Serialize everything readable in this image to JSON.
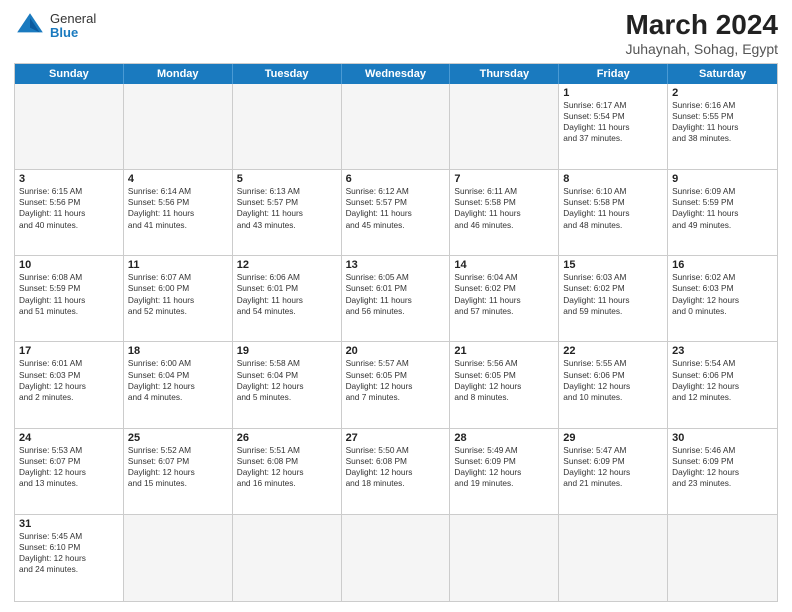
{
  "header": {
    "logo_general": "General",
    "logo_blue": "Blue",
    "month_year": "March 2024",
    "location": "Juhaynah, Sohag, Egypt"
  },
  "days_of_week": [
    "Sunday",
    "Monday",
    "Tuesday",
    "Wednesday",
    "Thursday",
    "Friday",
    "Saturday"
  ],
  "weeks": [
    [
      {
        "day": "",
        "info": "",
        "empty": true
      },
      {
        "day": "",
        "info": "",
        "empty": true
      },
      {
        "day": "",
        "info": "",
        "empty": true
      },
      {
        "day": "",
        "info": "",
        "empty": true
      },
      {
        "day": "",
        "info": "",
        "empty": true
      },
      {
        "day": "1",
        "info": "Sunrise: 6:17 AM\nSunset: 5:54 PM\nDaylight: 11 hours\nand 37 minutes.",
        "empty": false
      },
      {
        "day": "2",
        "info": "Sunrise: 6:16 AM\nSunset: 5:55 PM\nDaylight: 11 hours\nand 38 minutes.",
        "empty": false
      }
    ],
    [
      {
        "day": "3",
        "info": "Sunrise: 6:15 AM\nSunset: 5:56 PM\nDaylight: 11 hours\nand 40 minutes.",
        "empty": false
      },
      {
        "day": "4",
        "info": "Sunrise: 6:14 AM\nSunset: 5:56 PM\nDaylight: 11 hours\nand 41 minutes.",
        "empty": false
      },
      {
        "day": "5",
        "info": "Sunrise: 6:13 AM\nSunset: 5:57 PM\nDaylight: 11 hours\nand 43 minutes.",
        "empty": false
      },
      {
        "day": "6",
        "info": "Sunrise: 6:12 AM\nSunset: 5:57 PM\nDaylight: 11 hours\nand 45 minutes.",
        "empty": false
      },
      {
        "day": "7",
        "info": "Sunrise: 6:11 AM\nSunset: 5:58 PM\nDaylight: 11 hours\nand 46 minutes.",
        "empty": false
      },
      {
        "day": "8",
        "info": "Sunrise: 6:10 AM\nSunset: 5:58 PM\nDaylight: 11 hours\nand 48 minutes.",
        "empty": false
      },
      {
        "day": "9",
        "info": "Sunrise: 6:09 AM\nSunset: 5:59 PM\nDaylight: 11 hours\nand 49 minutes.",
        "empty": false
      }
    ],
    [
      {
        "day": "10",
        "info": "Sunrise: 6:08 AM\nSunset: 5:59 PM\nDaylight: 11 hours\nand 51 minutes.",
        "empty": false
      },
      {
        "day": "11",
        "info": "Sunrise: 6:07 AM\nSunset: 6:00 PM\nDaylight: 11 hours\nand 52 minutes.",
        "empty": false
      },
      {
        "day": "12",
        "info": "Sunrise: 6:06 AM\nSunset: 6:01 PM\nDaylight: 11 hours\nand 54 minutes.",
        "empty": false
      },
      {
        "day": "13",
        "info": "Sunrise: 6:05 AM\nSunset: 6:01 PM\nDaylight: 11 hours\nand 56 minutes.",
        "empty": false
      },
      {
        "day": "14",
        "info": "Sunrise: 6:04 AM\nSunset: 6:02 PM\nDaylight: 11 hours\nand 57 minutes.",
        "empty": false
      },
      {
        "day": "15",
        "info": "Sunrise: 6:03 AM\nSunset: 6:02 PM\nDaylight: 11 hours\nand 59 minutes.",
        "empty": false
      },
      {
        "day": "16",
        "info": "Sunrise: 6:02 AM\nSunset: 6:03 PM\nDaylight: 12 hours\nand 0 minutes.",
        "empty": false
      }
    ],
    [
      {
        "day": "17",
        "info": "Sunrise: 6:01 AM\nSunset: 6:03 PM\nDaylight: 12 hours\nand 2 minutes.",
        "empty": false
      },
      {
        "day": "18",
        "info": "Sunrise: 6:00 AM\nSunset: 6:04 PM\nDaylight: 12 hours\nand 4 minutes.",
        "empty": false
      },
      {
        "day": "19",
        "info": "Sunrise: 5:58 AM\nSunset: 6:04 PM\nDaylight: 12 hours\nand 5 minutes.",
        "empty": false
      },
      {
        "day": "20",
        "info": "Sunrise: 5:57 AM\nSunset: 6:05 PM\nDaylight: 12 hours\nand 7 minutes.",
        "empty": false
      },
      {
        "day": "21",
        "info": "Sunrise: 5:56 AM\nSunset: 6:05 PM\nDaylight: 12 hours\nand 8 minutes.",
        "empty": false
      },
      {
        "day": "22",
        "info": "Sunrise: 5:55 AM\nSunset: 6:06 PM\nDaylight: 12 hours\nand 10 minutes.",
        "empty": false
      },
      {
        "day": "23",
        "info": "Sunrise: 5:54 AM\nSunset: 6:06 PM\nDaylight: 12 hours\nand 12 minutes.",
        "empty": false
      }
    ],
    [
      {
        "day": "24",
        "info": "Sunrise: 5:53 AM\nSunset: 6:07 PM\nDaylight: 12 hours\nand 13 minutes.",
        "empty": false
      },
      {
        "day": "25",
        "info": "Sunrise: 5:52 AM\nSunset: 6:07 PM\nDaylight: 12 hours\nand 15 minutes.",
        "empty": false
      },
      {
        "day": "26",
        "info": "Sunrise: 5:51 AM\nSunset: 6:08 PM\nDaylight: 12 hours\nand 16 minutes.",
        "empty": false
      },
      {
        "day": "27",
        "info": "Sunrise: 5:50 AM\nSunset: 6:08 PM\nDaylight: 12 hours\nand 18 minutes.",
        "empty": false
      },
      {
        "day": "28",
        "info": "Sunrise: 5:49 AM\nSunset: 6:09 PM\nDaylight: 12 hours\nand 19 minutes.",
        "empty": false
      },
      {
        "day": "29",
        "info": "Sunrise: 5:47 AM\nSunset: 6:09 PM\nDaylight: 12 hours\nand 21 minutes.",
        "empty": false
      },
      {
        "day": "30",
        "info": "Sunrise: 5:46 AM\nSunset: 6:09 PM\nDaylight: 12 hours\nand 23 minutes.",
        "empty": false
      }
    ],
    [
      {
        "day": "31",
        "info": "Sunrise: 5:45 AM\nSunset: 6:10 PM\nDaylight: 12 hours\nand 24 minutes.",
        "empty": false
      },
      {
        "day": "",
        "info": "",
        "empty": true
      },
      {
        "day": "",
        "info": "",
        "empty": true
      },
      {
        "day": "",
        "info": "",
        "empty": true
      },
      {
        "day": "",
        "info": "",
        "empty": true
      },
      {
        "day": "",
        "info": "",
        "empty": true
      },
      {
        "day": "",
        "info": "",
        "empty": true
      }
    ]
  ]
}
